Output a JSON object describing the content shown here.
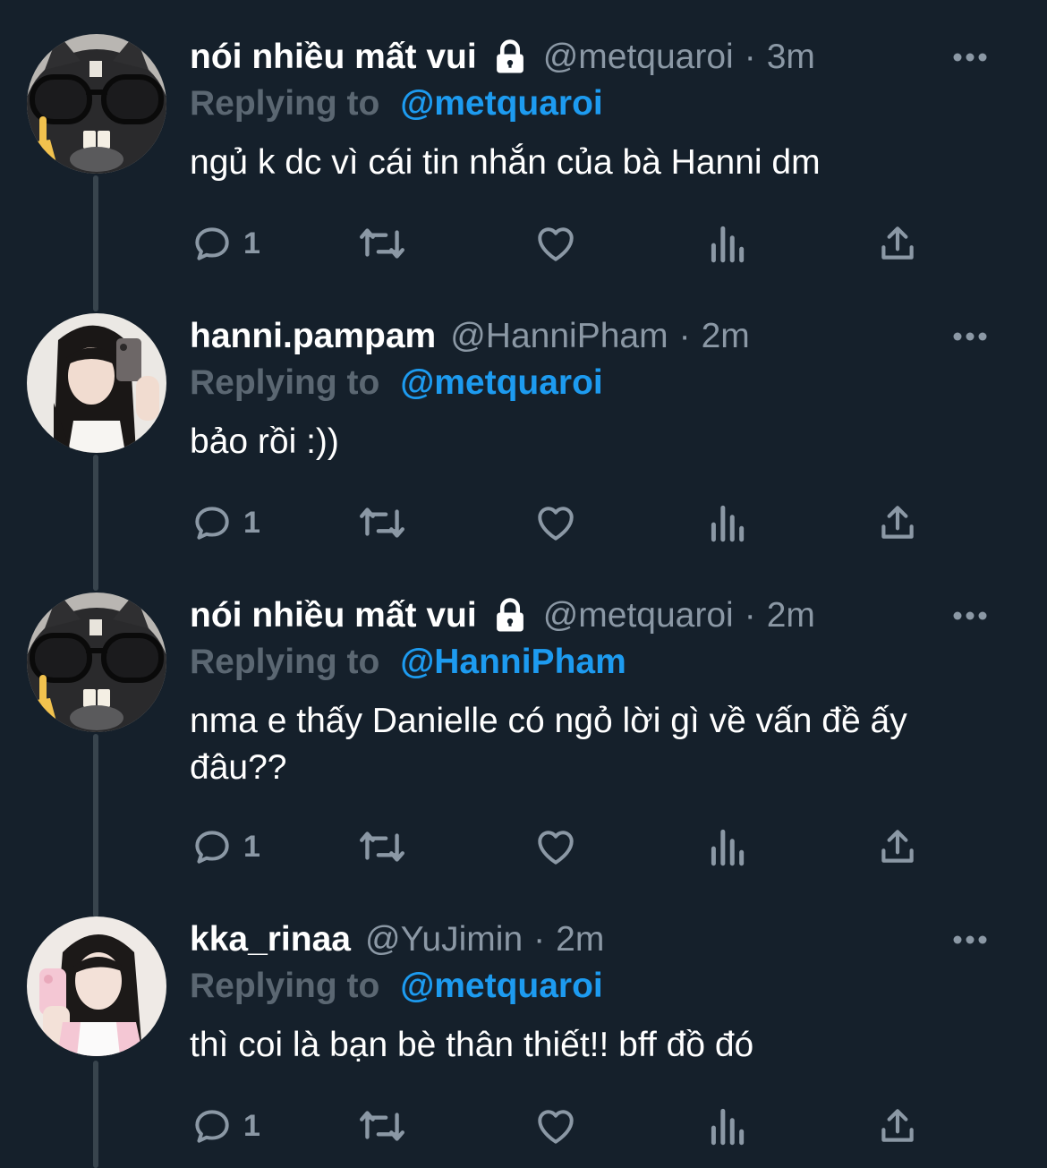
{
  "tweets": [
    {
      "display_name": "nói nhiều mất vui",
      "protected": true,
      "handle": "@metquaroi",
      "time": "3m",
      "reply_prefix": "Replying to",
      "reply_to": "@metquaroi",
      "text": "ngủ k dc vì cái tin nhắn của bà Hanni dm",
      "reply_count": "1",
      "avatar": "cat-with-glasses"
    },
    {
      "display_name": "hanni.pampam",
      "protected": false,
      "handle": "@HanniPham",
      "time": "2m",
      "reply_prefix": "Replying to",
      "reply_to": "@metquaroi",
      "text": "bảo rồi :))",
      "reply_count": "1",
      "avatar": "girl-mirror-selfie"
    },
    {
      "display_name": "nói nhiều mất vui",
      "protected": true,
      "handle": "@metquaroi",
      "time": "2m",
      "reply_prefix": "Replying to",
      "reply_to": "@HanniPham",
      "text": "nma e thấy Danielle có ngỏ lời gì về vấn đề ấy đâu??",
      "reply_count": "1",
      "avatar": "cat-with-glasses"
    },
    {
      "display_name": "kka_rinaa",
      "protected": false,
      "handle": "@YuJimin",
      "time": "2m",
      "reply_prefix": "Replying to",
      "reply_to": "@metquaroi",
      "text": "thì coi là bạn bè thân thiết!! bff đồ đó",
      "reply_count": "1",
      "avatar": "girl-with-phone"
    }
  ],
  "theme": {
    "background": "#15202b",
    "text": "#ffffff",
    "muted": "#8b98a5",
    "reply_prefix": "#5b6772",
    "mention": "#1d9bf0",
    "thread_line": "#38444d"
  },
  "icons": [
    "lock-icon",
    "more-icon",
    "reply-icon",
    "retweet-icon",
    "like-icon",
    "views-icon",
    "share-icon"
  ]
}
